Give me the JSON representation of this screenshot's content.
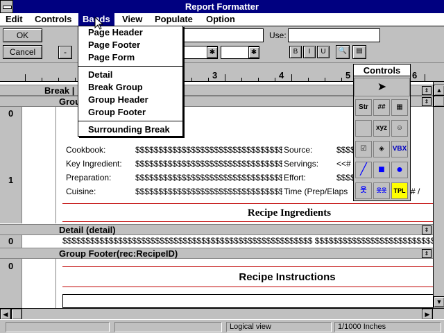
{
  "window": {
    "title": "Report Formatter"
  },
  "menubar": {
    "items": [
      {
        "label": "Edit"
      },
      {
        "label": "Controls"
      },
      {
        "label": "Bands"
      },
      {
        "label": "View"
      },
      {
        "label": "Populate"
      },
      {
        "label": "Option"
      }
    ]
  },
  "toolbar": {
    "ok_label": "OK",
    "cancel_label": "Cancel",
    "minus_label": "-",
    "use_label": "Use:",
    "use_value": ""
  },
  "ruler": {
    "numbers": [
      "3",
      "4",
      "5",
      "6"
    ]
  },
  "bands_menu": {
    "items": [
      {
        "label": "Page Header"
      },
      {
        "label": "Page Footer"
      },
      {
        "label": "Page Form"
      },
      {
        "label": "Detail"
      },
      {
        "label": "Break Group"
      },
      {
        "label": "Group Header"
      },
      {
        "label": "Group Footer"
      },
      {
        "label": "Surrounding Break"
      }
    ]
  },
  "palette": {
    "title": "Controls",
    "tools": [
      {
        "name": "pointer-icon",
        "glyph": "➤"
      },
      {
        "name": "string-tool",
        "glyph": "Str"
      },
      {
        "name": "format-tool",
        "glyph": "##"
      },
      {
        "name": "table-tool",
        "glyph": "▦"
      },
      {
        "name": "blank-tool",
        "glyph": ""
      },
      {
        "name": "xyz-tool",
        "glyph": "xyz"
      },
      {
        "name": "image-tool",
        "glyph": "☺"
      },
      {
        "name": "checkbox-tool",
        "glyph": "☑"
      },
      {
        "name": "radio-tool",
        "glyph": "◈"
      },
      {
        "name": "vbx-tool",
        "glyph": "VBX"
      },
      {
        "name": "line-tool",
        "glyph": "╱"
      },
      {
        "name": "rectangle-tool",
        "glyph": "■"
      },
      {
        "name": "ellipse-tool",
        "glyph": "●"
      },
      {
        "name": "person-tool",
        "glyph": "웃"
      },
      {
        "name": "group-tool",
        "glyph": "웃웃"
      },
      {
        "name": "tpl-tool",
        "glyph": "TPL"
      }
    ]
  },
  "report": {
    "bands": {
      "break_label": "Break |",
      "group_label": "Grou",
      "detail_label": "Detail (detail)",
      "group_footer_label": "Group Footer(rec:RecipeID)"
    },
    "vruler_numbers": [
      "0",
      "1",
      "0",
      "0"
    ],
    "fields": [
      {
        "label": "Cookbook:",
        "value": "$$$$$$$$$$$$$$$$$$$$$$$$$$$$$$$$$$",
        "label2": "Source:",
        "value2": "$$$$"
      },
      {
        "label": "Key Ingredient:",
        "value": "$$$$$$$$$$$$$$$$$$$$$$$$$$$$$$$$$$",
        "label2": "Servings:",
        "value2": "<<#"
      },
      {
        "label": "Preparation:",
        "value": "$$$$$$$$$$$$$$$$$$$$$$$$$$$$$$$$$$",
        "label2": "Effort:",
        "value2": "$$$$"
      },
      {
        "label": "Cuisine:",
        "value": "$$$$$$$$$$$$$$$$$$$$$$$$$$$$$$$$$$",
        "label2": "Time (Prep/Elaps",
        "value2": "# /"
      }
    ],
    "ingredients_heading": "Recipe Ingredients",
    "detail_row": "$$$$$$$$$$$$$$$$$$$$$$$$$$$$$$$$$$$$$$$$$$$$$$$$$$$$$$ $$$$$$$$$$$$$$$$$$$$$$$$$$$$$$$$$$$",
    "instructions_heading": "Recipe Instructions"
  },
  "statusbar": {
    "view": "Logical view",
    "units": "1/1000 Inches"
  }
}
